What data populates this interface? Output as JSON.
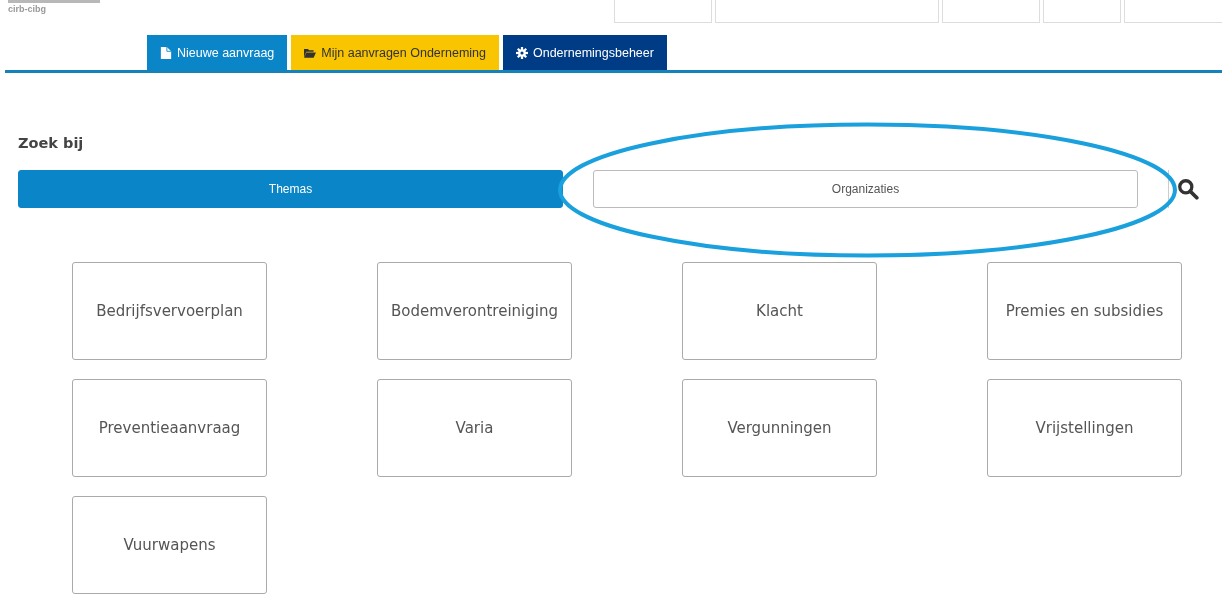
{
  "header": {
    "org": "cirb-cibg"
  },
  "nav_tabs": [
    {
      "label": "Nieuwe aanvraag",
      "kind": "file",
      "color": "#0a85c7"
    },
    {
      "label": "Mijn aanvragen Onderneming",
      "kind": "folder",
      "color": "#f9c400"
    },
    {
      "label": "Ondernemingsbeheer",
      "kind": "gear",
      "color": "#003c85"
    }
  ],
  "search_by": {
    "title": "Zoek bij",
    "options": [
      {
        "label": "Themas",
        "selected": true
      },
      {
        "label": "Organizaties",
        "selected": false
      }
    ]
  },
  "themes": [
    "Bedrijfsvervoerplan",
    "Bodemverontreiniging",
    "Klacht",
    "Premies en subsidies",
    "Preventieaanvraag",
    "Varia",
    "Vergunningen",
    "Vrijstellingen",
    "Vuurwapens"
  ]
}
